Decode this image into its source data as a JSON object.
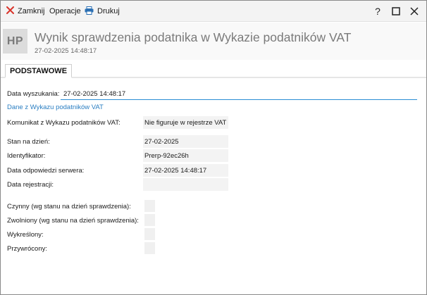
{
  "toolbar": {
    "close_label": "Zamknij",
    "close_icon": "close-x-icon",
    "operations_label": "Operacje",
    "print_label": "Drukuj",
    "print_icon": "printer-icon",
    "help_label": "?",
    "accent_close": "#d9342b",
    "accent_print": "#2a6fb3"
  },
  "header": {
    "avatar_text": "HP",
    "title": "Wynik sprawdzenia podatnika w Wykazie podatników VAT",
    "subtitle": "27-02-2025 14:48:17"
  },
  "tabs": [
    {
      "label": "PODSTAWOWE",
      "active": true
    }
  ],
  "form": {
    "search_date_label": "Data wyszukania:",
    "search_date_value": "27-02-2025 14:48:17",
    "section_title": "Dane z Wykazu podatników VAT",
    "fields": [
      {
        "label": "Komunikat z Wykazu podatników VAT:",
        "value": "Nie figuruje w rejestrze VAT"
      },
      {
        "label": "Stan na dzień:",
        "value": "27-02-2025"
      },
      {
        "label": "Identyfikator:",
        "value": "Prerp-92ec26h"
      },
      {
        "label": "Data odpowiedzi serwera:",
        "value": "27-02-2025 14:48:17"
      },
      {
        "label": "Data rejestracji:",
        "value": ""
      }
    ],
    "checkboxes": [
      {
        "label": "Czynny (wg stanu na dzień sprawdzenia):",
        "checked": false
      },
      {
        "label": "Zwolniony (wg stanu na dzień sprawdzenia):",
        "checked": false
      },
      {
        "label": "Wykreślony:",
        "checked": false
      },
      {
        "label": "Przywrócony:",
        "checked": false
      }
    ]
  },
  "colors": {
    "link": "#2a7ec2",
    "focus_underline": "#2a8dd4",
    "field_bg": "#f3f3f3"
  }
}
